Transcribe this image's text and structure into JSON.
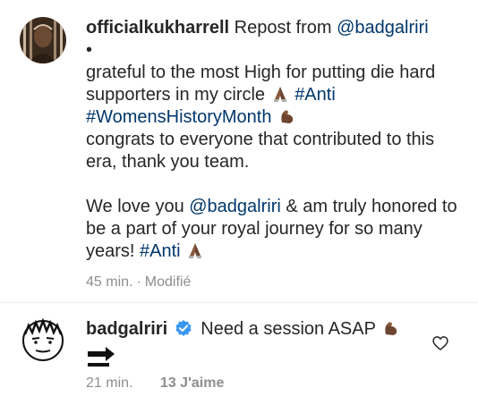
{
  "caption": {
    "username": "officialkukharrell",
    "repost_prefix": "Repost from",
    "repost_handle": "@badgalriri",
    "bullet": "•",
    "line1": "grateful to the most High for putting die hard supporters in my circle",
    "hashtag_anti": "#Anti",
    "hashtag_whm": "#WomensHistoryMonth",
    "line2": "congrats to everyone that contributed to this era, thank you team.",
    "line3_a": "We love you",
    "mention": "@badgalriri",
    "line3_b": "& am truly honored to be a part of your royal journey for so many years!",
    "hashtag_anti_end": "#Anti",
    "time": "45 min.",
    "meta_sep": "·",
    "edited": "Modifié"
  },
  "reply": {
    "username": "badgalriri",
    "text": "Need a session ASAP",
    "time": "21 min.",
    "likes": "13 J'aime"
  },
  "colors": {
    "text": "#262626",
    "link": "#00376b",
    "muted": "#8e8e8e",
    "verified": "#3897f0",
    "divider": "#efefef"
  },
  "icons": {
    "verified": "verified-badge-icon",
    "pray": "praying-hands-icon",
    "flex": "flexed-biceps-icon",
    "soon": "soon-arrow-icon",
    "heart": "heart-outline-icon"
  }
}
